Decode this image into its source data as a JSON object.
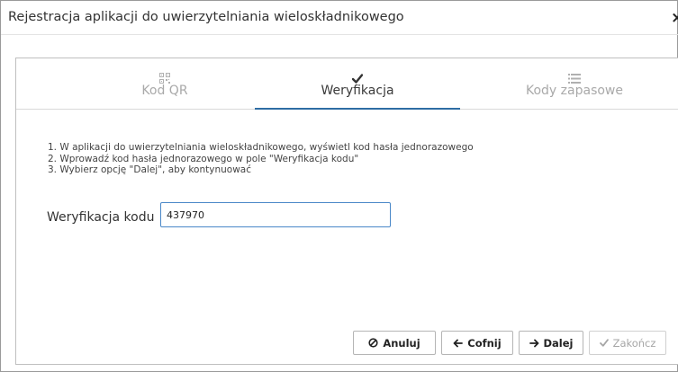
{
  "dialog": {
    "title": "Rejestracja aplikacji do uwierzytelniania wieloskładnikowego",
    "close_label": "×"
  },
  "steps": [
    {
      "label": "Kod QR",
      "icon": "qr-code-icon",
      "state": "inactive"
    },
    {
      "label": "Weryfikacja",
      "icon": "checkmark-icon",
      "state": "active"
    },
    {
      "label": "Kody zapasowe",
      "icon": "list-icon",
      "state": "inactive"
    }
  ],
  "instructions": [
    "1. W aplikacji do uwierzytelniania wieloskładnikowego, wyświetl kod hasła jednorazowego",
    "2. Wprowadź kod hasła jednorazowego w pole \"Weryfikacja kodu\"",
    "3. Wybierz opcję \"Dalej\", aby kontynuować"
  ],
  "verification": {
    "label": "Weryfikacja kodu",
    "value": "437970"
  },
  "buttons": {
    "cancel": {
      "label": "Anuluj",
      "icon": "ban-icon"
    },
    "back": {
      "label": "Cofnij",
      "icon": "arrow-left-icon"
    },
    "next": {
      "label": "Dalej",
      "icon": "arrow-right-icon"
    },
    "finish": {
      "label": "Zakończ",
      "icon": "checkmark-icon",
      "disabled": true
    }
  },
  "colors": {
    "accent": "#2e6da4",
    "input_border": "#4a88c8",
    "inactive_text": "#a9a9a9"
  }
}
